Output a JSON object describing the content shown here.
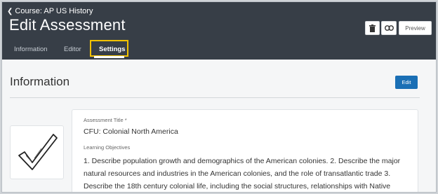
{
  "header": {
    "back_label": "Course: AP US History",
    "title": "Edit Assessment",
    "tabs": [
      {
        "label": "Information"
      },
      {
        "label": "Editor"
      },
      {
        "label": "Settings"
      }
    ],
    "preview_label": "Preview"
  },
  "section": {
    "title": "Information",
    "edit_label": "Edit"
  },
  "assessment": {
    "title_label": "Assessment Title *",
    "title_value": "CFU: Colonial North America",
    "objectives_label": "Learning Objectives",
    "objectives_text": "1. Describe population growth and demographics of the American colonies. 2. Describe the major natural resources and industries in the American colonies, and the role of transatlantic trade 3. Describe the 18th century colonial life, including the social structures, relationships with Native"
  },
  "colors": {
    "header_bg": "#373e47",
    "accent": "#1a6fb5",
    "highlight": "#f2c200"
  },
  "icons": [
    "chevron-left-icon",
    "trash-icon",
    "link-icon",
    "checkmark-icon"
  ]
}
